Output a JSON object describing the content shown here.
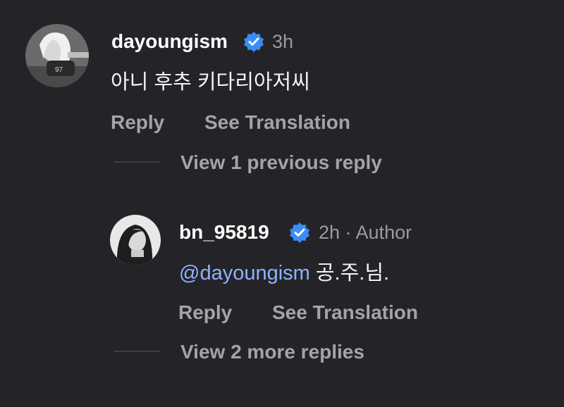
{
  "comments": {
    "main": {
      "username": "dayoungism",
      "time": "3h",
      "text": "아니 후추 키다리아저씨",
      "reply_label": "Reply",
      "translate_label": "See Translation",
      "avatar_icon": "user-avatar-photo",
      "verified_icon": "verified-badge-icon",
      "view_previous_label": "View 1 previous reply"
    },
    "reply": {
      "username": "bn_95819",
      "time": "2h · Author",
      "mention": "@dayoungism",
      "text": " 공.주.님.",
      "reply_label": "Reply",
      "translate_label": "See Translation",
      "avatar_icon": "user-avatar-photo",
      "verified_icon": "verified-badge-icon",
      "view_more_label": "View 2 more replies"
    }
  },
  "colors": {
    "background": "#242428",
    "username": "#ffffff",
    "secondary": "#a3a3aa",
    "mention": "#8fb2ff",
    "verified": "#3b8cf7"
  }
}
